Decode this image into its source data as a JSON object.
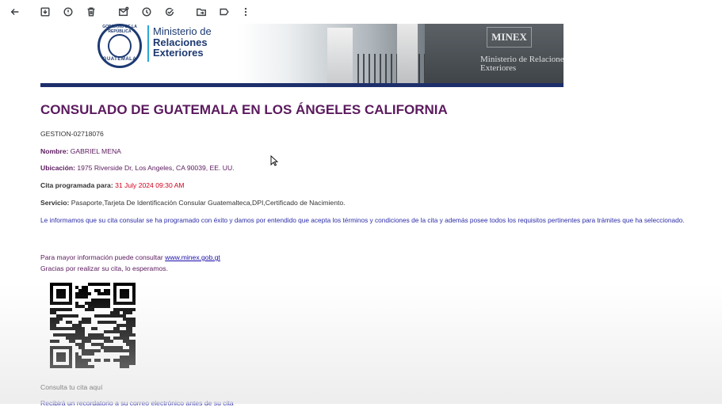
{
  "toolbar": {
    "icons": [
      "back-arrow-icon",
      "archive-icon",
      "report-spam-icon",
      "delete-icon",
      "mark-unread-icon",
      "snooze-icon",
      "add-to-tasks-icon",
      "move-to-icon",
      "label-icon",
      "more-vert-icon"
    ]
  },
  "banner": {
    "seal_top": "GOBIERNO DE LA REPÚBLICA",
    "seal_bottom": "GUATEMALA",
    "ministry_line1": "Ministerio de",
    "ministry_line2": "Relaciones",
    "ministry_line3": "Exteriores",
    "sign": "MINEX",
    "sign_sub": "Ministerio de Relaciones Exteriores"
  },
  "email": {
    "title": "CONSULADO DE GUATEMALA EN LOS ÁNGELES CALIFORNIA",
    "gestion": "GESTION-02718076",
    "nombre_label": "Nombre:",
    "nombre_value": "GABRIEL MENA",
    "ubicacion_label": "Ubicación:",
    "ubicacion_value": "1975 Riverside Dr, Los Angeles, CA 90039, EE. UU.",
    "cita_label": "Cita programada para:",
    "cita_value": "31 July 2024 09:30 AM",
    "servicio_label": "Servicio:",
    "servicio_value": "Pasaporte,Tarjeta De Identificación Consular Guatemalteca,DPI,Certificado de Nacimiento.",
    "info_text": "Le informamos que su cita consular se ha programado con éxito y damos por entendido que acepta los términos y condiciones de la cita y además posee todos los requisitos pertinentes para trámites que ha seleccionado.",
    "more_info_text": "Para mayor información puede consultar",
    "more_info_link": "www.minex.gob.gt",
    "thanks": "Gracias por realizar su cita, lo esperamos.",
    "consulta": "Consulta tu cita aquí",
    "footer_partial": "Recibirá un recordatorio a su correo electrónico antes de su cita"
  },
  "colors": {
    "heading": "#5b1a5e",
    "date": "#d0021b",
    "info": "#2c2ca8",
    "banner_bar": "#1d2f6b"
  }
}
